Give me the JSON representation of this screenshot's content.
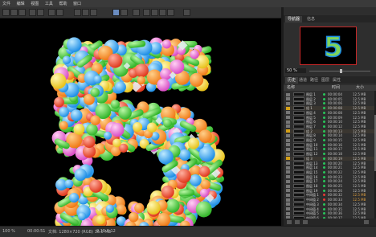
{
  "menubar": {
    "items": [
      "文件",
      "编辑",
      "视图",
      "工具",
      "帮助",
      "窗口"
    ]
  },
  "viewer_tab": "5",
  "navigator": {
    "tabs": [
      "导航器",
      "信息"
    ],
    "zoom_value": "50 %"
  },
  "history": {
    "tabs": [
      "历史",
      "通道",
      "路径",
      "图层",
      "属性"
    ],
    "panel_title": "历史",
    "columns": {
      "name": "名称",
      "time": "时间",
      "size": "大小"
    },
    "rows": [
      {
        "name": "图层 1",
        "time": "00:00:04",
        "size": "12.5 MB",
        "status": "#28c45a",
        "folder": false
      },
      {
        "name": "图层 2",
        "time": "00:00:05",
        "size": "12.5 MB",
        "status": "#28c45a",
        "folder": false
      },
      {
        "name": "图层 3",
        "time": "00:00:06",
        "size": "12.5 MB",
        "status": "#28c45a",
        "folder": false
      },
      {
        "name": "组 1",
        "time": "00:00:08",
        "size": "12.5 MB",
        "status": "#28c45a",
        "folder": true
      },
      {
        "name": "图层 4",
        "time": "00:00:08",
        "size": "12.5 MB",
        "status": "#28c45a",
        "folder": false
      },
      {
        "name": "图层 5",
        "time": "00:00:09",
        "size": "12.5 MB",
        "status": "#28c45a",
        "folder": false
      },
      {
        "name": "图层 6",
        "time": "00:00:10",
        "size": "12.5 MB",
        "status": "#28c45a",
        "folder": false
      },
      {
        "name": "图层 7",
        "time": "00:00:12",
        "size": "12.5 MB",
        "status": "#28c45a",
        "folder": false
      },
      {
        "name": "组 2",
        "time": "00:00:13",
        "size": "12.5 MB",
        "status": "#28c45a",
        "folder": true
      },
      {
        "name": "图层 8",
        "time": "00:00:14",
        "size": "12.5 MB",
        "status": "#28c45a",
        "folder": false
      },
      {
        "name": "图层 9",
        "time": "00:00:15",
        "size": "12.5 MB",
        "status": "#28c45a",
        "folder": false
      },
      {
        "name": "图层 10",
        "time": "00:00:16",
        "size": "12.5 MB",
        "status": "#28c45a",
        "folder": false
      },
      {
        "name": "图层 11",
        "time": "00:00:17",
        "size": "12.5 MB",
        "status": "#28c45a",
        "folder": false
      },
      {
        "name": "图层 12",
        "time": "00:00:18",
        "size": "12.5 MB",
        "status": "#28c45a",
        "folder": false
      },
      {
        "name": "组 3",
        "time": "00:00:19",
        "size": "12.5 MB",
        "status": "#28c45a",
        "folder": true
      },
      {
        "name": "图层 13",
        "time": "00:00:20",
        "size": "12.5 MB",
        "status": "#28c45a",
        "folder": false
      },
      {
        "name": "图层 14",
        "time": "00:00:21",
        "size": "12.5 MB",
        "status": "#28c45a",
        "folder": false
      },
      {
        "name": "图层 15",
        "time": "00:00:22",
        "size": "12.5 MB",
        "status": "#28c45a",
        "folder": false
      },
      {
        "name": "图层 16",
        "time": "00:00:23",
        "size": "12.5 MB",
        "status": "#28c45a",
        "folder": false
      },
      {
        "name": "图层 17",
        "time": "00:00:24",
        "size": "12.5 MB",
        "status": "#28c45a",
        "folder": false
      },
      {
        "name": "图层 18",
        "time": "00:00:25",
        "size": "12.5 MB",
        "status": "#28c45a",
        "folder": false
      },
      {
        "name": "图层 19",
        "time": "00:00:26",
        "size": "12.5 MB",
        "status": "#28c45a",
        "folder": false
      },
      {
        "name": "中间值 1",
        "time": "00:00:32",
        "size": "12.5 MB",
        "status": "#e53935",
        "folder": false
      },
      {
        "name": "中间值 2",
        "time": "00:00:33",
        "size": "12.5 MB",
        "status": "#e53935",
        "folder": false
      },
      {
        "name": "中间值 3",
        "time": "00:00:34",
        "size": "12.5 MB",
        "status": "#28c45a",
        "folder": false
      },
      {
        "name": "中间值 4",
        "time": "00:00:35",
        "size": "12.5 MB",
        "status": "#28c45a",
        "folder": false
      },
      {
        "name": "中间值 5",
        "time": "00:00:36",
        "size": "12.5 MB",
        "status": "#28c45a",
        "folder": false
      },
      {
        "name": "中间值 6",
        "time": "00:00:37",
        "size": "12.5 MB",
        "status": "#28c45a",
        "folder": false
      }
    ]
  },
  "statusbar": {
    "zoom": "100 %",
    "time": "00:00:51",
    "doc": "文档: 1280×720 (RGB) 16.0 MB",
    "coords": "0.15 0.12"
  },
  "colors": {
    "accent": "#6a8cc0",
    "canvas_bg": "#000000"
  },
  "icons": [
    "new-icon",
    "open-icon",
    "save-icon",
    "undo-icon",
    "redo-icon",
    "crop-icon",
    "brush-icon",
    "select-icon",
    "move-icon",
    "zoom-icon",
    "hand-icon",
    "eye-icon",
    "folder-icon"
  ]
}
